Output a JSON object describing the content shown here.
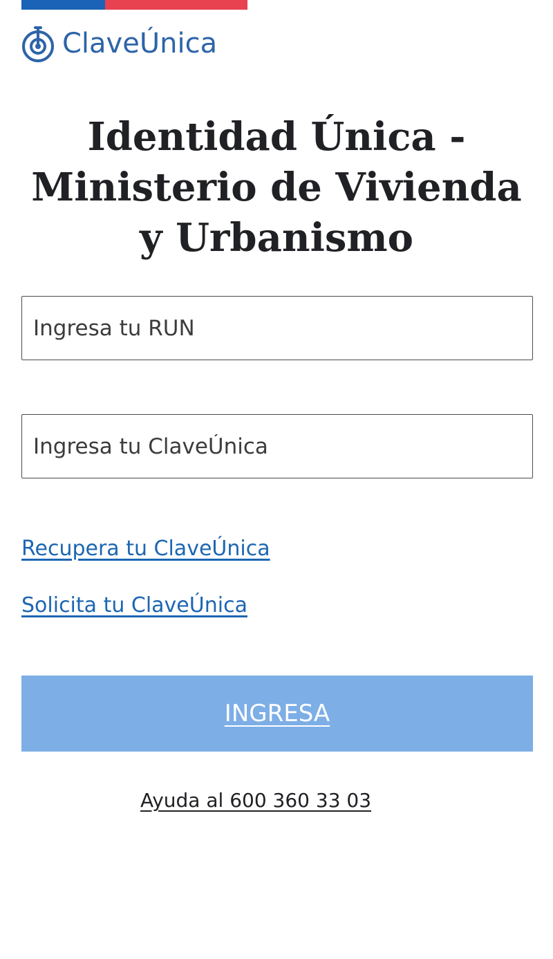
{
  "header": {
    "flag_colors": {
      "blue": "#1a63b6",
      "red": "#e8414f"
    },
    "logo": {
      "icon": "claveunica-logo-icon",
      "text": "ClaveÚnica",
      "color": "#2d64a8"
    }
  },
  "page": {
    "title": "Identidad Única - Ministerio de Vivienda y Urbanismo"
  },
  "form": {
    "run_field": {
      "placeholder": "Ingresa tu RUN",
      "value": ""
    },
    "clave_field": {
      "placeholder": "Ingresa tu ClaveÚnica",
      "value": ""
    },
    "recover_link": "Recupera tu ClaveÚnica",
    "request_link": "Solicita tu ClaveÚnica",
    "submit_label": "INGRESA",
    "submit_color": "#7daee6"
  },
  "footer": {
    "help_text": "Ayuda al 600 360 33 03"
  }
}
